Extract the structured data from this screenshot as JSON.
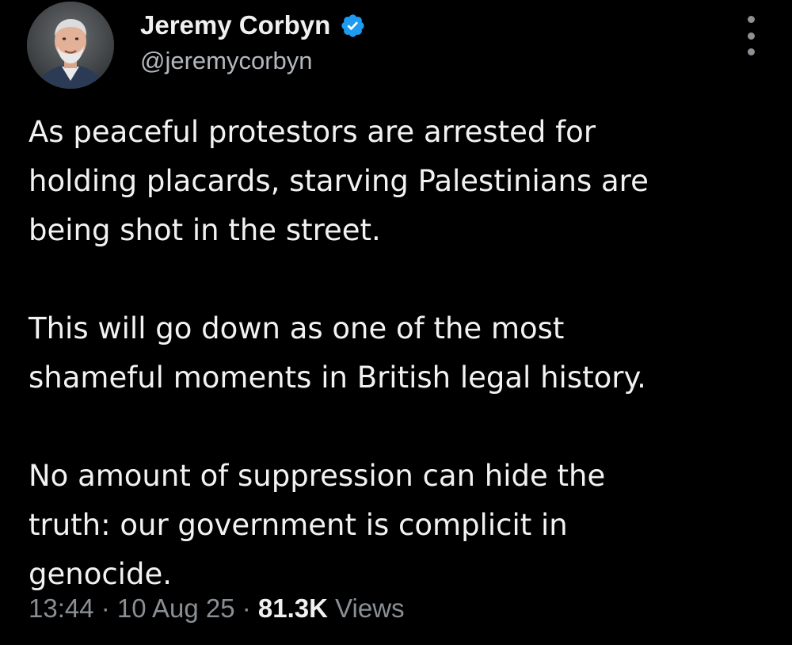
{
  "author": {
    "name": "Jeremy Corbyn",
    "handle": "@jeremycorbyn",
    "verified_icon": "verified-badge-icon",
    "avatar_icon": "profile-photo"
  },
  "tweet": {
    "paragraphs": [
      [
        "As peaceful protestors are arrested for",
        "holding placards, starving Palestinians are",
        "being shot in the street."
      ],
      [
        "This will go down as one of the most",
        "shameful moments in British legal history."
      ],
      [
        "No amount of suppression can hide the",
        "truth: our government is complicit in",
        "genocide."
      ]
    ]
  },
  "meta": {
    "time": "13:44",
    "separator": " · ",
    "date": "10 Aug 25",
    "views_count": "81.3K",
    "views_label": " Views"
  },
  "colors": {
    "background": "#000000",
    "text": "#f2f2f2",
    "muted": "#8a8f94",
    "verified": "#1d9bf0"
  }
}
